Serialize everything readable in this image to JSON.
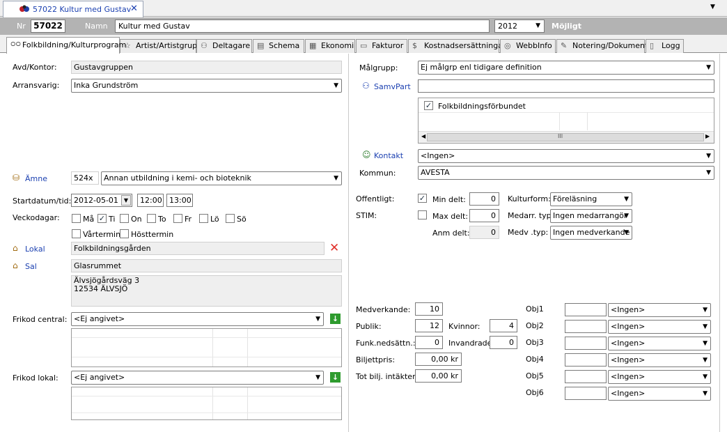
{
  "window": {
    "doc_tab_title": "57022  Kultur med Gustav",
    "close_icon": "✕",
    "dropdown_icon": "▼"
  },
  "header": {
    "nr_label": "Nr",
    "nr_value": "57022",
    "name_label": "Namn",
    "name_value": "Kultur med Gustav",
    "year_value": "2012",
    "status": "Möjligt"
  },
  "tabs": [
    {
      "label": "Folkbildning/Kulturprogram",
      "icon": "glasses-icon"
    },
    {
      "label": "Artist/Artistgrupp",
      "icon": "star-icon"
    },
    {
      "label": "Deltagare",
      "icon": "people-icon"
    },
    {
      "label": "Schema",
      "icon": "schedule-icon"
    },
    {
      "label": "Ekonomi",
      "icon": "calculator-icon"
    },
    {
      "label": "Fakturor",
      "icon": "invoice-icon"
    },
    {
      "label": "Kostnadsersättningar",
      "icon": "money-icon"
    },
    {
      "label": "WebbInfo",
      "icon": "globe-icon"
    },
    {
      "label": "Notering/Dokument",
      "icon": "notes-icon"
    },
    {
      "label": "Logg",
      "icon": "log-icon"
    }
  ],
  "left": {
    "avd_label": "Avd/Kontor:",
    "avd_value": "Gustavgruppen",
    "arr_label": "Arransvarig:",
    "arr_value": "Inka Grundström",
    "amne_label": "Ämne",
    "amne_code": "524x",
    "amne_value": "Annan utbildning i kemi- och bioteknik",
    "start_label": "Startdatum/tid:",
    "start_date": "2012-05-01",
    "start_time": "12:00",
    "end_time": "13:00",
    "vecko_label": "Veckodagar:",
    "days": [
      {
        "label": "Må",
        "checked": false
      },
      {
        "label": "Ti",
        "checked": true
      },
      {
        "label": "On",
        "checked": false
      },
      {
        "label": "To",
        "checked": false
      },
      {
        "label": "Fr",
        "checked": false
      },
      {
        "label": "Lö",
        "checked": false
      },
      {
        "label": "Sö",
        "checked": false
      }
    ],
    "vartermin": "Vårtermin",
    "hosttermin": "Hösttermin",
    "lokal_label": "Lokal",
    "lokal_value": "Folkbildningsgården",
    "sal_label": "Sal",
    "sal_value": "Glasrummet",
    "address_line1": "Älvsjögårdsväg 3",
    "address_line2": "12534 ÄLVSJÖ",
    "frikod_central_label": "Frikod central:",
    "frikod_central_value": "<Ej angivet>",
    "frikod_lokal_label": "Frikod lokal:",
    "frikod_lokal_value": "<Ej angivet>"
  },
  "right": {
    "malgrupp_label": "Målgrupp:",
    "malgrupp_value": "Ej målgrp enl tidigare definition",
    "samvpart_label": "SamvPart",
    "samvpart_value": "",
    "samvpart_item": "Folkbildningsförbundet",
    "scroll_grip": "III",
    "kontakt_label": "Kontakt",
    "kontakt_value": "<Ingen>",
    "kommun_label": "Kommun:",
    "kommun_value": "AVESTA",
    "offentligt_label": "Offentligt:",
    "offentligt_checked": true,
    "stim_label": "STIM:",
    "stim_checked": false,
    "min_delt_label": "Min delt:",
    "min_delt_value": "0",
    "max_delt_label": "Max delt:",
    "max_delt_value": "0",
    "anm_delt_label": "Anm delt:",
    "anm_delt_value": "0",
    "kulturform_label": "Kulturform:",
    "kulturform_value": "Föreläsning",
    "medarr_label": "Medarr. typ:",
    "medarr_value": "Ingen medarrangör",
    "medv_label": "Medv .typ:",
    "medv_value": "Ingen medverkande",
    "medverkande_label": "Medverkande:",
    "medverkande_value": "10",
    "publik_label": "Publik:",
    "publik_value": "12",
    "kvinnor_label": "Kvinnor:",
    "kvinnor_value": "4",
    "funk_label": "Funk.nedsättn.:",
    "funk_value": "0",
    "invandrade_label": "Invandrade:",
    "invandrade_value": "0",
    "biljett_label": "Biljettpris:",
    "biljett_value": "0,00 kr",
    "totbilj_label": "Tot bilj. intäkter:",
    "totbilj_value": "0,00 kr",
    "objs": [
      {
        "label": "Obj1",
        "value": "<Ingen>"
      },
      {
        "label": "Obj2",
        "value": "<Ingen>"
      },
      {
        "label": "Obj3",
        "value": "<Ingen>"
      },
      {
        "label": "Obj4",
        "value": "<Ingen>"
      },
      {
        "label": "Obj5",
        "value": "<Ingen>"
      },
      {
        "label": "Obj6",
        "value": "<Ingen>"
      }
    ]
  }
}
